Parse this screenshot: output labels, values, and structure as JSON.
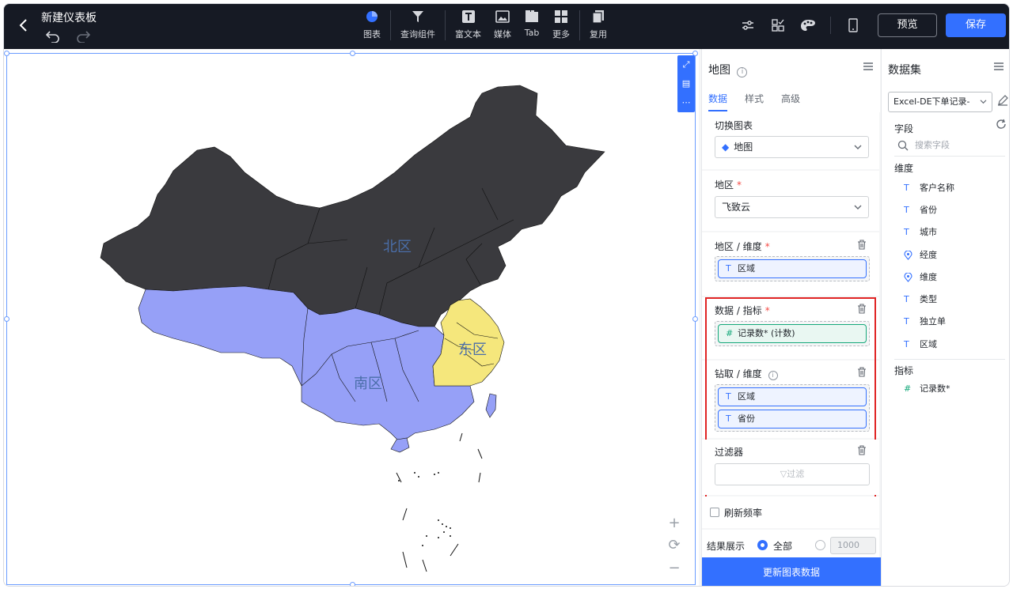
{
  "header": {
    "title": "新建仪表板",
    "tools": [
      {
        "label": "图表",
        "icon": "chart-pie-icon"
      },
      {
        "label": "查询组件",
        "icon": "filter-funnel-icon"
      },
      {
        "label": "富文本",
        "icon": "rich-text-icon"
      },
      {
        "label": "媒体",
        "icon": "media-image-icon"
      },
      {
        "label": "Tab",
        "icon": "tab-icon"
      },
      {
        "label": "更多",
        "icon": "grid-more-icon"
      },
      {
        "label": "复用",
        "icon": "copy-reuse-icon"
      }
    ],
    "preview_label": "预览",
    "save_label": "保存"
  },
  "map": {
    "regions": [
      {
        "label": "北区",
        "color": "#3a3a3e"
      },
      {
        "label": "东区",
        "color": "#f5e77c"
      },
      {
        "label": "南区",
        "color": "#96a0f7"
      }
    ],
    "label_color": "#4a6ea9"
  },
  "panel": {
    "title": "地图",
    "tabs": [
      "数据",
      "样式",
      "高级"
    ],
    "active_tab": "数据",
    "switch_chart_label": "切换图表",
    "switch_chart_value": "地图",
    "region_label": "地区",
    "region_value": "飞致云",
    "region_dimension_label": "地区 / 维度",
    "region_dimension_chip": "区域",
    "data_metric_label": "数据 / 指标",
    "data_metric_chip": "记录数* (计数)",
    "drill_label": "钻取 / 维度",
    "drill_chips": [
      "区域",
      "省份"
    ],
    "filter_label": "过滤器",
    "filter_button": "过滤",
    "refresh_label": "刷新频率",
    "result_label": "结果展示",
    "result_all": "全部",
    "result_limit": "1000",
    "update_button": "更新图表数据"
  },
  "dataset": {
    "title": "数据集",
    "selected": "Excel-DE下单记录-",
    "fields_label": "字段",
    "search_placeholder": "搜索字段",
    "dimension_label": "维度",
    "dimensions": [
      {
        "name": "客户名称",
        "type": "T"
      },
      {
        "name": "省份",
        "type": "T"
      },
      {
        "name": "城市",
        "type": "T"
      },
      {
        "name": "经度",
        "type": "location-pin"
      },
      {
        "name": "维度",
        "type": "location-pin"
      },
      {
        "name": "类型",
        "type": "T"
      },
      {
        "name": "独立单",
        "type": "T"
      },
      {
        "name": "区域",
        "type": "T"
      }
    ],
    "metric_label": "指标",
    "metrics": [
      {
        "name": "记录数*",
        "type": "#"
      }
    ]
  },
  "colors": {
    "accent": "#3370ff",
    "topbar": "#161a24",
    "highlight_border": "#e02424"
  }
}
